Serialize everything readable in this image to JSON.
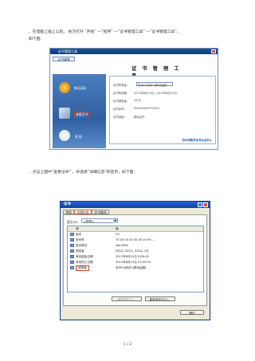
{
  "step1_text": "、在电脑上插上以后，    依次打开 “开始” —“程序” —“证书管理工具”    —“证书管理工具”，",
  "step1_text2": "如下图：",
  "app1": {
    "title": "证书管理工具",
    "tab": "证书管理",
    "banner": "证 书 管 理 工 具",
    "side_items": [
      "移动证码",
      "查看证书",
      "帮 助"
    ],
    "fields": [
      {
        "label": "证书所有者：",
        "value": "苏州CA测试1(移动监管)"
      },
      {
        "label": "证书有效期：",
        "value": "2011年8月15日—2012年8月15日"
      },
      {
        "label": "证书颁发者：",
        "value": "SZCA"
      },
      {
        "label": "证书序号：",
        "value": "0000000007F0411"
      },
      {
        "label": "证书用途：",
        "value": "移动证书"
      }
    ],
    "footer": "苏州市数字证书认证中心"
  },
  "step2_text": "、点击上图中“查看证书”    ，并选择“详细信息”标签页，如下图：",
  "app2": {
    "title": "证书",
    "tabs": [
      "常规",
      "详细信息",
      "证书路径"
    ],
    "show_label": "显示(S):",
    "show_value": "<所有>",
    "columns": [
      "域",
      "值"
    ],
    "rows": [
      {
        "field": "版本",
        "value": "V3"
      },
      {
        "field": "序列号",
        "value": "70 00 00 00 00 00 00 99 ..."
      },
      {
        "field": "签名算法",
        "value": "sha1RSA"
      },
      {
        "field": "颁发者",
        "value": "SZCA, SZCA, SZCA, CN"
      },
      {
        "field": "有效起始日期",
        "value": "2011年8月15日 0:00:00"
      },
      {
        "field": "有效终止日期",
        "value": "2012年8月15日 23:59:59"
      },
      {
        "field": "使用者",
        "value": "苏州CA测试1(移动监管)"
      }
    ],
    "btn_edit": "编辑属性(E)...",
    "btn_copy": "复制到文件(C)...",
    "btn_ok": "确定"
  },
  "page_number": "1 / 2"
}
